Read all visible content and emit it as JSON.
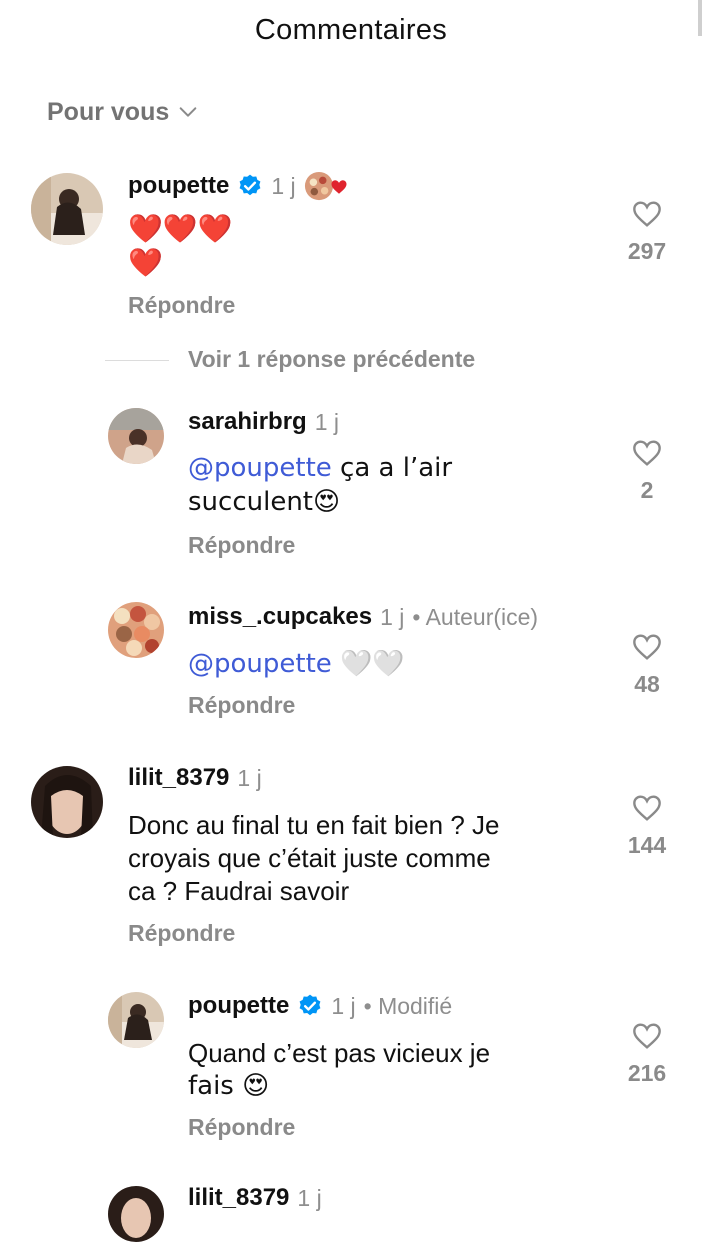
{
  "header": {
    "title": "Commentaires"
  },
  "sort": {
    "label": "Pour vous"
  },
  "comments": [
    {
      "username": "poupette",
      "verified": true,
      "time": "1 j",
      "text": "❤️❤️❤️",
      "text2": "❤️",
      "reply": "Répondre",
      "likes": "297"
    },
    {
      "username": "sarahirbrg",
      "time": "1 j",
      "mention": "@poupette",
      "text": " ça a l’air",
      "text2": "succulent😍",
      "reply": "Répondre",
      "likes": "2"
    },
    {
      "username": "miss_.cupcakes",
      "time": "1 j",
      "extra": "• Auteur(ice)",
      "mention": "@poupette",
      "text": " 🤍🤍",
      "reply": "Répondre",
      "likes": "48"
    },
    {
      "username": "lilit_8379",
      "time": "1 j",
      "text": "Donc au final tu en fait bien ? Je",
      "text2": "croyais que c’était juste comme",
      "text3": "ca ? Faudrai savoir",
      "reply": "Répondre",
      "likes": "144"
    },
    {
      "username": "poupette",
      "verified": true,
      "time": "1 j",
      "extra": "• Modifié",
      "text": "Quand c’est pas vicieux je",
      "text2": "fais 😍",
      "reply": "Répondre",
      "likes": "216"
    }
  ],
  "replies_toggle": {
    "label": "Voir 1 réponse précédente"
  },
  "partial": {
    "username": "lilit_8379",
    "time": "1 j"
  },
  "colors": {
    "verified": "#0095f6",
    "mention": "#3f5bd6",
    "heart_red": "#e0242e"
  },
  "icons": [
    "chevron-down-icon",
    "verified-badge-icon",
    "heart-outline-icon"
  ]
}
